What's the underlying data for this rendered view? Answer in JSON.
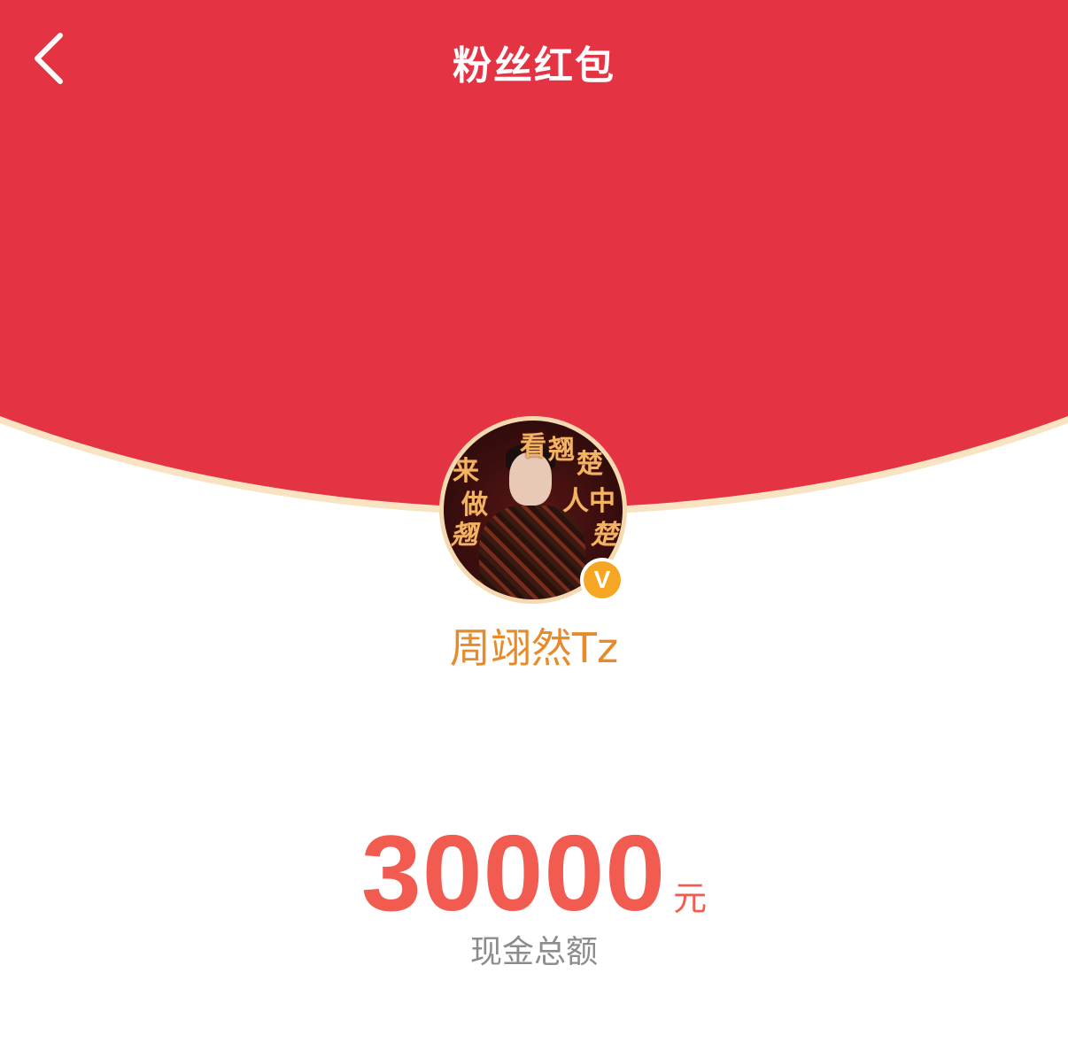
{
  "nav": {
    "title": "粉丝红包"
  },
  "avatar": {
    "poster_text": [
      "来",
      "看",
      "翘",
      "楚",
      "做",
      "人",
      "中",
      "翘",
      "楚"
    ],
    "verified_mark": "V"
  },
  "user": {
    "name": "周翊然Tz"
  },
  "packet": {
    "amount": "30000",
    "unit": "元",
    "caption": "现金总额"
  },
  "colors": {
    "header_red": "#e43342",
    "rim_cream": "#f8e3c3",
    "username_orange": "#e78a2a",
    "amount_red": "#f25b4f",
    "caption_gray": "#8c8c8c",
    "verified_gold": "#f6a623"
  },
  "icons": {
    "back": "chevron-left-icon",
    "verified": "verified-badge-icon"
  }
}
